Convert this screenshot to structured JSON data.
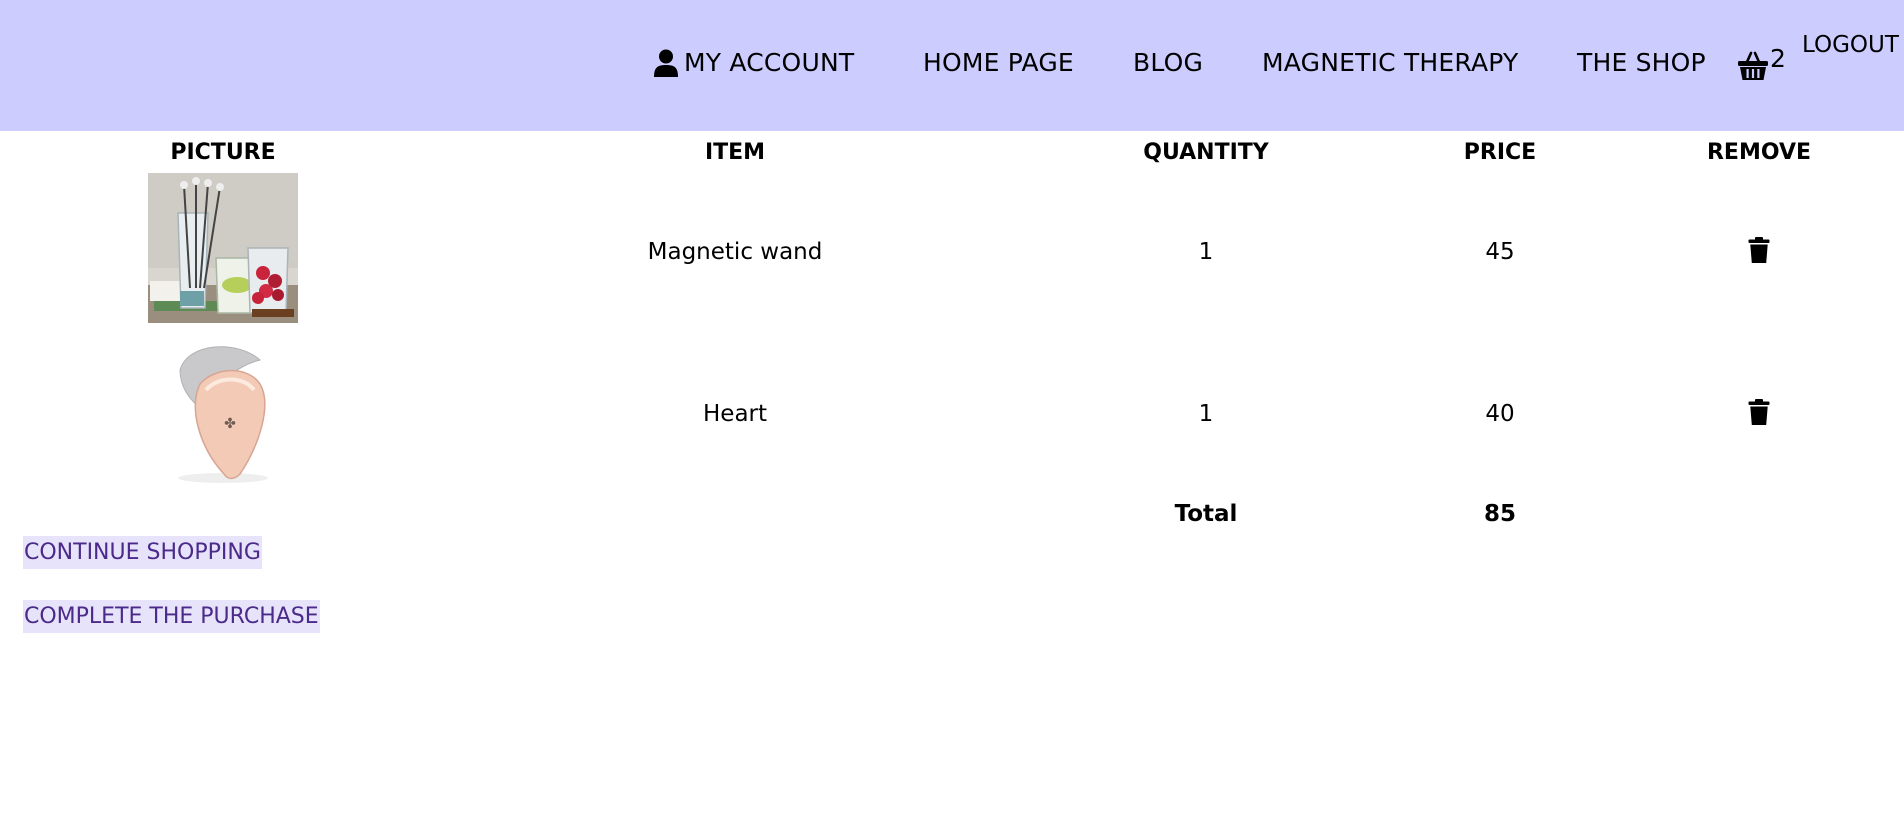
{
  "header": {
    "nav": {
      "account": "MY ACCOUNT",
      "home": "HOME PAGE",
      "blog": "BLOG",
      "therapy": "MAGNETIC THERAPY",
      "shop": "THE SHOP"
    },
    "cart_count": "2",
    "logout": "LOGOUT",
    "icons": {
      "account": "user-icon",
      "cart": "shopping-basket-icon"
    },
    "colors": {
      "header_bg": "#ccccff"
    }
  },
  "table": {
    "headers": {
      "picture": "PICTURE",
      "item": "ITEM",
      "quantity": "QUANTITY",
      "price": "PRICE",
      "remove": "REMOVE"
    },
    "rows": [
      {
        "item": "Magnetic wand",
        "quantity": "1",
        "price": "45"
      },
      {
        "item": "Heart",
        "quantity": "1",
        "price": "40"
      }
    ],
    "total_label": "Total",
    "total_value": "85",
    "remove_icon": "trash-icon"
  },
  "actions": {
    "continue": "CONTINUE SHOPPING",
    "complete": "COMPLETE THE PURCHASE"
  },
  "colors": {
    "link_text": "#4b2a8a",
    "link_bg": "#e6e3fb"
  }
}
